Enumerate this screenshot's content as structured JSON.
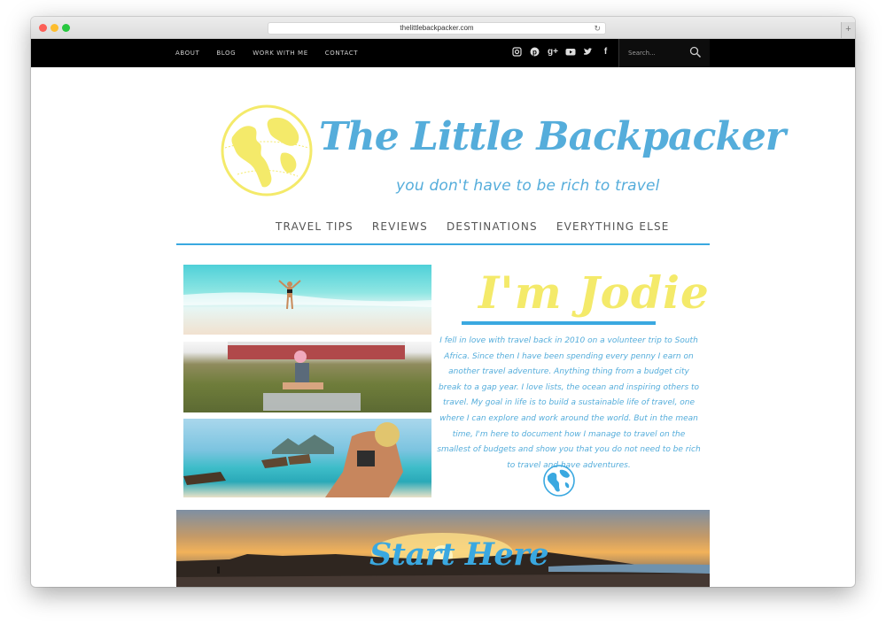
{
  "browser": {
    "url": "thelittlebackpacker.com"
  },
  "topnav": {
    "items": [
      "ABOUT",
      "BLOG",
      "WORK WITH ME",
      "CONTACT"
    ]
  },
  "social": {
    "icons": [
      "instagram-icon",
      "pinterest-icon",
      "google-plus-icon",
      "youtube-icon",
      "twitter-icon",
      "facebook-icon"
    ]
  },
  "search": {
    "placeholder": "Search..."
  },
  "header": {
    "title": "The Little Backpacker",
    "tagline": "you don't have to be rich to travel"
  },
  "mainnav": {
    "items": [
      "TRAVEL TIPS",
      "REVIEWS",
      "DESTINATIONS",
      "EVERYTHING ELSE"
    ]
  },
  "intro": {
    "heading": "I'm Jodie",
    "bio": "I fell in love with travel back in 2010 on a volunteer trip to South Africa. Since then I have been spending every penny I earn on another travel adventure. Anything thing from a budget city break to a gap year. I love lists, the ocean and inspiring others to travel. My goal in life is to build a sustainable life of travel, one where I can explore and work around the world. But in the mean time, I'm here to document how I manage to travel on the smallest of budgets and show you that you do not need to be rich to travel and have adventures."
  },
  "banner": {
    "cta": "Start Here"
  },
  "colors": {
    "accent": "#3aa8e0",
    "title_blue": "#55addb",
    "logo_yellow": "#f4ea6a",
    "nav_black": "#000000"
  }
}
